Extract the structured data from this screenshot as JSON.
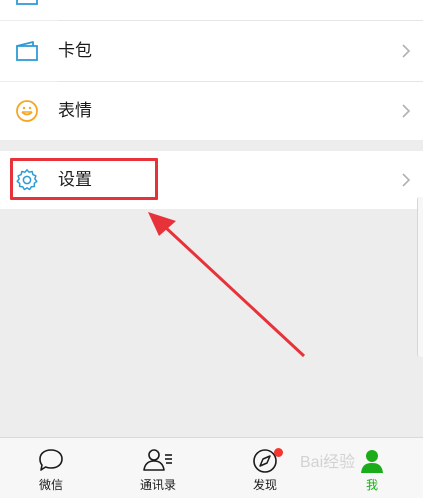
{
  "menu": {
    "items": [
      {
        "label": "",
        "icon": "menu-item-icon"
      },
      {
        "label": "卡包",
        "icon": "card-wallet-icon"
      },
      {
        "label": "表情",
        "icon": "smiley-icon"
      },
      {
        "label": "设置",
        "icon": "gear-icon"
      }
    ]
  },
  "tabbar": {
    "tabs": [
      {
        "label": "微信",
        "icon": "chat-bubble-icon",
        "active": false
      },
      {
        "label": "通讯录",
        "icon": "contacts-icon",
        "active": false
      },
      {
        "label": "发现",
        "icon": "compass-icon",
        "active": false,
        "badge": true
      },
      {
        "label": "我",
        "icon": "person-icon",
        "active": true
      }
    ]
  },
  "watermark": {
    "text": "Bai经验"
  },
  "colors": {
    "accent_green": "#1aad19",
    "highlight_red": "#e8323a",
    "icon_blue": "#2f9bd6",
    "icon_orange": "#f5a623",
    "badge_red": "#f43530"
  }
}
